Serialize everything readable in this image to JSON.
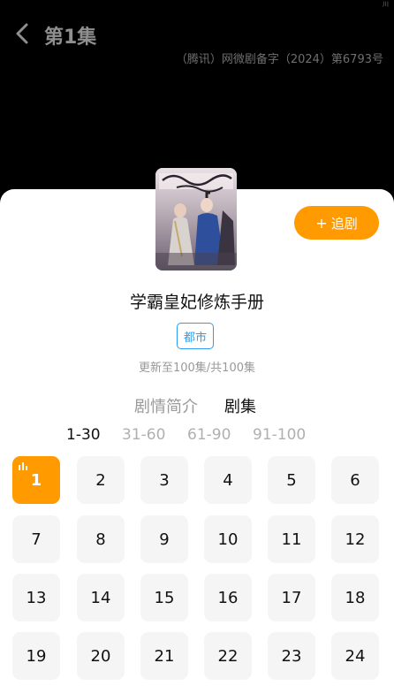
{
  "header": {
    "episode_title": "第1集",
    "license": "（腾讯）网微剧备字（2024）第6793号",
    "status_glyph": "川"
  },
  "drama": {
    "title": "学霸皇妃修炼手册",
    "genre": "都市",
    "update_info": "更新至100集/共100集",
    "follow_label": "追剧",
    "follow_plus": "+"
  },
  "tabs": [
    "剧情简介",
    "剧集"
  ],
  "ranges": [
    "1-30",
    "31-60",
    "61-90",
    "91-100"
  ],
  "episodes": [
    "1",
    "2",
    "3",
    "4",
    "5",
    "6",
    "7",
    "8",
    "9",
    "10",
    "11",
    "12",
    "13",
    "14",
    "15",
    "16",
    "17",
    "18",
    "19",
    "20",
    "21",
    "22",
    "23",
    "24"
  ],
  "colors": {
    "accent": "#FF9A00",
    "tag": "#2e9bf0"
  }
}
